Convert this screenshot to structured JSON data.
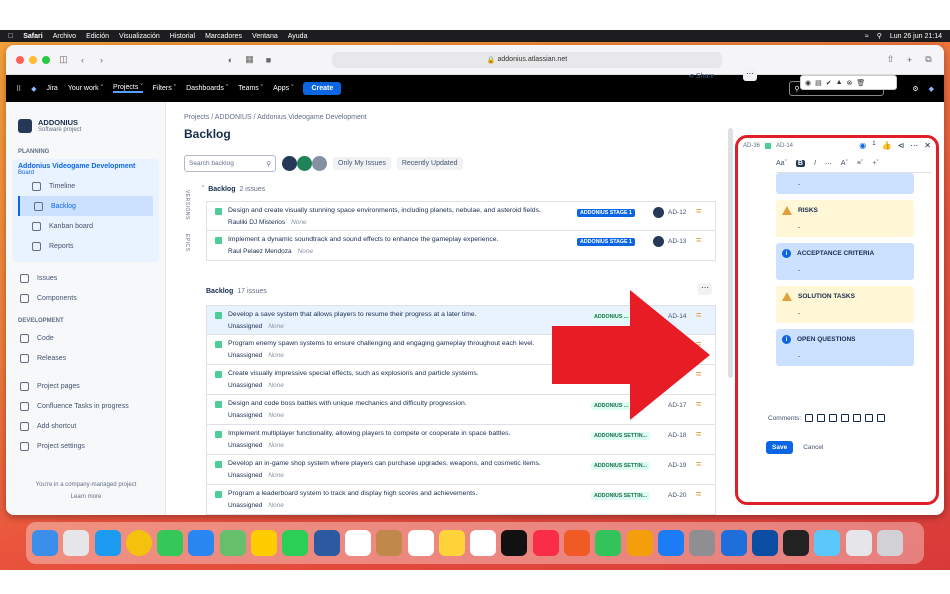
{
  "mac": {
    "menu": [
      "Safari",
      "Archivo",
      "Edición",
      "Visualización",
      "Historial",
      "Marcadores",
      "Ventana",
      "Ayuda"
    ],
    "clock": "Lun 26 jun 21:14"
  },
  "browser": {
    "url": "addonius.atlassian.net"
  },
  "jira_nav": {
    "app": "Jira",
    "items": [
      "Your work",
      "Projects",
      "Filters",
      "Dashboards",
      "Teams",
      "Apps"
    ],
    "create": "Create",
    "search_placeholder": "Search"
  },
  "sidebar": {
    "project_name": "ADDONIUS",
    "project_type": "Software project",
    "planning_label": "PLANNING",
    "board_title": "Addonius Videogame Development",
    "board_sub": "Board",
    "planning_items": [
      "Timeline",
      "Backlog",
      "Kanban board",
      "Reports"
    ],
    "other_items": [
      "Issues",
      "Components"
    ],
    "development_label": "DEVELOPMENT",
    "dev_items": [
      "Code",
      "Releases"
    ],
    "bottom_items": [
      "Project pages",
      "Confluence Tasks in progress",
      "Add shortcut",
      "Project settings"
    ],
    "footer_line1": "You're in a company-managed project",
    "footer_line2": "Learn more"
  },
  "main": {
    "breadcrumb": "Projects  /  ADDONIUS  /  Addonius Videogame Development",
    "title": "Backlog",
    "share": "Share",
    "search_placeholder": "Search backlog",
    "filter_only_my": "Only My Issues",
    "filter_recent": "Recently Updated",
    "versions_tab": "VERSIONS",
    "epics_tab": "EPICS",
    "section1_title": "Backlog",
    "section1_count": "2 issues",
    "section2_title": "Backlog",
    "section2_count": "17 issues"
  },
  "issues_top": [
    {
      "summary": "Design and create visually stunning space environments, including planets, nebulae, and asteroid fields.",
      "assignee": "Rauliki DJ Misterios",
      "none": "None",
      "epic": "ADDONIUS STAGE 1",
      "key": "AD-12",
      "priority": "="
    },
    {
      "summary": "Implement a dynamic soundtrack and sound effects to enhance the gameplay experience.",
      "assignee": "Raul Pelaez Mendoza",
      "none": "None",
      "epic": "ADDONIUS STAGE 1",
      "key": "AD-13",
      "priority": "="
    }
  ],
  "issues": [
    {
      "summary": "Develop a save system that allows players to resume their progress at a later time.",
      "assignee": "Unassigned",
      "none": "None",
      "epic": "ADDONIUS ...",
      "key": "AD-14",
      "priority": "="
    },
    {
      "summary": "Program enemy spawn systems to ensure challenging and engaging gameplay throughout each level.",
      "assignee": "Unassigned",
      "none": "None",
      "epic": "",
      "key": "",
      "priority": "="
    },
    {
      "summary": "Create visually impressive special effects, such as explosions and particle systems.",
      "assignee": "Unassigned",
      "none": "None",
      "epic": "",
      "key": "",
      "priority": "="
    },
    {
      "summary": "Design and code boss battles with unique mechanics and difficulty progression.",
      "assignee": "Unassigned",
      "none": "None",
      "epic": "ADDONIUS ...",
      "key": "AD-17",
      "priority": "="
    },
    {
      "summary": "Implement multiplayer functionality, allowing players to compete or cooperate in space battles.",
      "assignee": "Unassigned",
      "none": "None",
      "epic": "ADDONIUS SETTIN...",
      "key": "AD-18",
      "priority": "="
    },
    {
      "summary": "Develop an in-game shop system where players can purchase upgrades, weapons, and cosmetic items.",
      "assignee": "Unassigned",
      "none": "None",
      "epic": "ADDONIUS SETTIN...",
      "key": "AD-19",
      "priority": "="
    },
    {
      "summary": "Program a leaderboard system to track and display high scores and achievements.",
      "assignee": "Unassigned",
      "none": "None",
      "epic": "ADDONIUS SETTIN...",
      "key": "AD-20",
      "priority": "="
    }
  ],
  "panel": {
    "breadcrumb_prev": "AD-36",
    "breadcrumb_key": "AD-14",
    "watchers": "1",
    "toolbar_text": "Aa",
    "blocks": [
      {
        "title": "",
        "value": "-",
        "color": "blue"
      },
      {
        "title": "RISKS",
        "value": "-",
        "color": "yellow"
      },
      {
        "title": "ACCEPTANCE CRITERIA",
        "value": "-",
        "color": "blue"
      },
      {
        "title": "SOLUTION TASKS",
        "value": "-",
        "color": "yellow"
      },
      {
        "title": "OPEN QUESTIONS",
        "value": "-",
        "color": "blue"
      }
    ],
    "comments_label": "Comments:",
    "save": "Save",
    "cancel": "Cancel"
  },
  "colors": {
    "accent": "#0c66e4",
    "highlight": "#e11f26",
    "arrow": "#e81c24"
  }
}
